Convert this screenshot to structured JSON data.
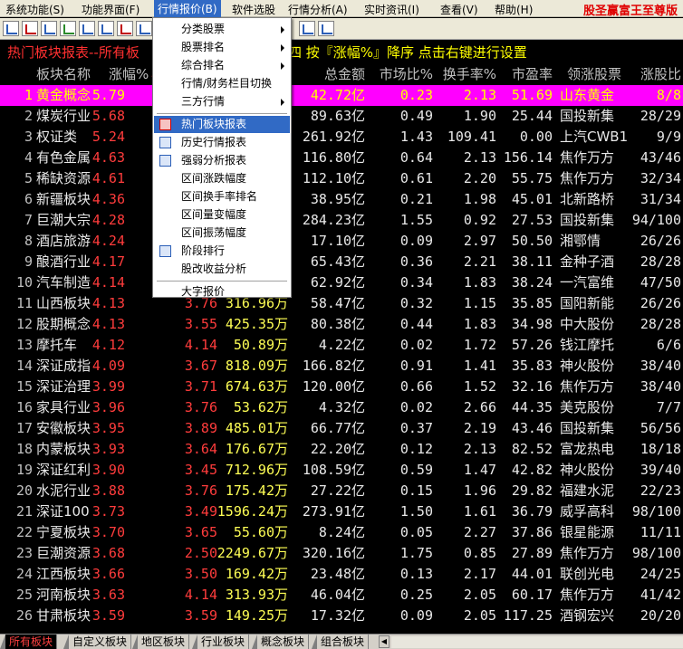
{
  "menubar": {
    "items": [
      "系统功能(S)",
      "功能界面(F)",
      "行情报价(B)",
      "软件选股",
      "行情分析(A)",
      "实时资讯(I)",
      "查看(V)",
      "帮助(H)"
    ],
    "brand": "股圣赢富王至尊版"
  },
  "title": {
    "left": "热门板块报表--所有板",
    "right": "四  按『涨幅%』降序  点击右键进行设置"
  },
  "header": {
    "name": "板块名称",
    "change": "涨幅%",
    "change_arrow": "↓",
    "total_amount": "总金额",
    "market_ratio": "市场比%",
    "turnover": "换手率%",
    "pe": "市盈率",
    "leader": "领涨股票",
    "rise_ratio": "涨股比"
  },
  "rows": [
    {
      "n": "1",
      "name": "黄金概念",
      "chg": "5.79",
      "c3": "",
      "c4": "",
      "amt": "42.72亿",
      "mkt": "0.23",
      "tr": "2.13",
      "pe": "51.69",
      "lead": "山东黄金",
      "lead_cyan": false,
      "ratio": "8/8"
    },
    {
      "n": "2",
      "name": "煤炭行业",
      "chg": "5.68",
      "c3": "",
      "c4": "",
      "amt": "89.63亿",
      "mkt": "0.49",
      "tr": "1.90",
      "pe": "25.44",
      "lead": "国投新集",
      "lead_cyan": false,
      "ratio": "28/29"
    },
    {
      "n": "3",
      "name": "权证类",
      "chg": "5.24",
      "c3": "",
      "c4": "",
      "amt": "261.92亿",
      "mkt": "1.43",
      "tr": "109.41",
      "pe": "0.00",
      "lead": "上汽CWB1",
      "lead_cyan": false,
      "ratio": "9/9"
    },
    {
      "n": "4",
      "name": "有色金属",
      "chg": "4.63",
      "c3": "",
      "c4": "",
      "amt": "116.80亿",
      "mkt": "0.64",
      "tr": "2.13",
      "pe": "156.14",
      "lead": "焦作万方",
      "lead_cyan": true,
      "ratio": "43/46"
    },
    {
      "n": "5",
      "name": "稀缺资源",
      "chg": "4.61",
      "c3": "",
      "c4": "",
      "amt": "112.10亿",
      "mkt": "0.61",
      "tr": "2.20",
      "pe": "55.75",
      "lead": "焦作万方",
      "lead_cyan": true,
      "ratio": "32/34"
    },
    {
      "n": "6",
      "name": "新疆板块",
      "chg": "4.36",
      "c3": "",
      "c4": "",
      "amt": "38.95亿",
      "mkt": "0.21",
      "tr": "1.98",
      "pe": "45.01",
      "lead": "北新路桥",
      "lead_cyan": false,
      "ratio": "31/34"
    },
    {
      "n": "7",
      "name": "巨潮大宗",
      "chg": "4.28",
      "c3": "",
      "c4": "",
      "amt": "284.23亿",
      "mkt": "1.55",
      "tr": "0.92",
      "pe": "27.53",
      "lead": "国投新集",
      "lead_cyan": false,
      "ratio": "94/100"
    },
    {
      "n": "8",
      "name": "酒店旅游",
      "chg": "4.24",
      "c3": "",
      "c4": "",
      "amt": "17.10亿",
      "mkt": "0.09",
      "tr": "2.97",
      "pe": "50.50",
      "lead": "湘鄂情",
      "lead_cyan": false,
      "ratio": "26/26"
    },
    {
      "n": "9",
      "name": "酿酒行业",
      "chg": "4.17",
      "c3": "",
      "c4": "",
      "amt": "65.43亿",
      "mkt": "0.36",
      "tr": "2.21",
      "pe": "38.11",
      "lead": "金种子酒",
      "lead_cyan": false,
      "ratio": "28/28"
    },
    {
      "n": "10",
      "name": "汽车制造",
      "chg": "4.14",
      "c3": "",
      "c4": "",
      "amt": "62.92亿",
      "mkt": "0.34",
      "tr": "1.83",
      "pe": "38.24",
      "lead": "一汽富维",
      "lead_cyan": false,
      "ratio": "47/50"
    },
    {
      "n": "11",
      "name": "山西板块",
      "chg": "4.13",
      "c3": "3.76",
      "c4": "316.96万",
      "amt": "58.47亿",
      "mkt": "0.32",
      "tr": "1.15",
      "pe": "35.85",
      "lead": "国阳新能",
      "lead_cyan": false,
      "ratio": "26/26"
    },
    {
      "n": "12",
      "name": "股期概念",
      "chg": "4.13",
      "c3": "3.55",
      "c4": "425.35万",
      "amt": "80.38亿",
      "mkt": "0.44",
      "tr": "1.83",
      "pe": "34.98",
      "lead": "中大股份",
      "lead_cyan": false,
      "ratio": "28/28"
    },
    {
      "n": "13",
      "name": "摩托车",
      "chg": "4.12",
      "c3": "4.14",
      "c4": "50.89万",
      "amt": "4.22亿",
      "mkt": "0.02",
      "tr": "1.72",
      "pe": "57.26",
      "lead": "钱江摩托",
      "lead_cyan": false,
      "ratio": "6/6"
    },
    {
      "n": "14",
      "name": "深证成指",
      "chg": "4.09",
      "c3": "3.67",
      "c4": "818.09万",
      "amt": "166.82亿",
      "mkt": "0.91",
      "tr": "1.41",
      "pe": "35.83",
      "lead": "神火股份",
      "lead_cyan": false,
      "ratio": "38/40"
    },
    {
      "n": "15",
      "name": "深证治理",
      "chg": "3.99",
      "c3": "3.71",
      "c4": "674.63万",
      "amt": "120.00亿",
      "mkt": "0.66",
      "tr": "1.52",
      "pe": "32.16",
      "lead": "焦作万方",
      "lead_cyan": true,
      "ratio": "38/40"
    },
    {
      "n": "16",
      "name": "家具行业",
      "chg": "3.96",
      "c3": "3.76",
      "c4": "53.62万",
      "amt": "4.32亿",
      "mkt": "0.02",
      "tr": "2.66",
      "pe": "44.35",
      "lead": "美克股份",
      "lead_cyan": false,
      "ratio": "7/7"
    },
    {
      "n": "17",
      "name": "安徽板块",
      "chg": "3.95",
      "c3": "3.89",
      "c4": "485.01万",
      "amt": "66.77亿",
      "mkt": "0.37",
      "tr": "2.19",
      "pe": "43.46",
      "lead": "国投新集",
      "lead_cyan": false,
      "ratio": "56/56"
    },
    {
      "n": "18",
      "name": "内蒙板块",
      "chg": "3.93",
      "c3": "3.64",
      "c4": "176.67万",
      "amt": "22.20亿",
      "mkt": "0.12",
      "tr": "2.13",
      "pe": "82.52",
      "lead": "富龙热电",
      "lead_cyan": false,
      "ratio": "18/18"
    },
    {
      "n": "19",
      "name": "深证红利",
      "chg": "3.90",
      "c3": "3.45",
      "c4": "712.96万",
      "amt": "108.59亿",
      "mkt": "0.59",
      "tr": "1.47",
      "pe": "42.82",
      "lead": "神火股份",
      "lead_cyan": false,
      "ratio": "39/40"
    },
    {
      "n": "20",
      "name": "水泥行业",
      "chg": "3.88",
      "c3": "3.76",
      "c4": "175.42万",
      "amt": "27.22亿",
      "mkt": "0.15",
      "tr": "1.96",
      "pe": "29.82",
      "lead": "福建水泥",
      "lead_cyan": false,
      "ratio": "22/23"
    },
    {
      "n": "21",
      "name": "深证100",
      "chg": "3.73",
      "c3": "3.49",
      "c4": "1596.24万",
      "amt": "273.91亿",
      "mkt": "1.50",
      "tr": "1.61",
      "pe": "36.79",
      "lead": "威孚高科",
      "lead_cyan": false,
      "ratio": "98/100"
    },
    {
      "n": "22",
      "name": "宁夏板块",
      "chg": "3.70",
      "c3": "3.65",
      "c4": "55.60万",
      "amt": "8.24亿",
      "mkt": "0.05",
      "tr": "2.27",
      "pe": "37.86",
      "lead": "银星能源",
      "lead_cyan": false,
      "ratio": "11/11"
    },
    {
      "n": "23",
      "name": "巨潮资源",
      "chg": "3.68",
      "c3": "2.50",
      "c4": "2249.67万",
      "amt": "320.16亿",
      "mkt": "1.75",
      "tr": "0.85",
      "pe": "27.89",
      "lead": "焦作万方",
      "lead_cyan": true,
      "ratio": "98/100"
    },
    {
      "n": "24",
      "name": "江西板块",
      "chg": "3.66",
      "c3": "3.50",
      "c4": "169.42万",
      "amt": "23.48亿",
      "mkt": "0.13",
      "tr": "2.17",
      "pe": "44.01",
      "lead": "联创光电",
      "lead_cyan": false,
      "ratio": "24/25"
    },
    {
      "n": "25",
      "name": "河南板块",
      "chg": "3.63",
      "c3": "4.14",
      "c4": "313.93万",
      "amt": "46.04亿",
      "mkt": "0.25",
      "tr": "2.05",
      "pe": "60.17",
      "lead": "焦作万方",
      "lead_cyan": true,
      "ratio": "41/42"
    },
    {
      "n": "26",
      "name": "甘肃板块",
      "chg": "3.59",
      "c3": "3.59",
      "c4": "149.25万",
      "amt": "17.32亿",
      "mkt": "0.09",
      "tr": "2.05",
      "pe": "117.25",
      "lead": "酒钢宏兴",
      "lead_cyan": false,
      "ratio": "20/20"
    }
  ],
  "dropdown": {
    "items": [
      {
        "label": "分类股票",
        "submenu": true
      },
      {
        "label": "股票排名",
        "submenu": true
      },
      {
        "label": "综合排名",
        "submenu": true
      },
      {
        "label": "行情/财务栏目切换",
        "submenu": false
      },
      {
        "label": "三方行情",
        "submenu": true
      },
      {
        "label": "热门板块报表",
        "submenu": false,
        "highlighted": true,
        "icon": "hot-sector-icon"
      },
      {
        "label": "历史行情报表",
        "submenu": false,
        "icon": "history-report-icon"
      },
      {
        "label": "强弱分析报表",
        "submenu": false,
        "icon": "strength-report-icon"
      },
      {
        "label": "区间涨跌幅度",
        "submenu": false
      },
      {
        "label": "区间换手率排名",
        "submenu": false
      },
      {
        "label": "区间量变幅度",
        "submenu": false
      },
      {
        "label": "区间振荡幅度",
        "submenu": false
      },
      {
        "label": "阶段排行",
        "submenu": false,
        "icon": "stage-rank-icon"
      },
      {
        "label": "股改收益分析",
        "submenu": false
      },
      {
        "label": "大字报价",
        "submenu": false
      }
    ]
  },
  "tabs": [
    "所有板块",
    "自定义板块",
    "地区板块",
    "行业板块",
    "概念板块",
    "组合板块"
  ],
  "colors": {
    "selected_row": "#ff00ff",
    "up_red": "#ff3c3c",
    "highlight_blue": "#316ac5"
  }
}
